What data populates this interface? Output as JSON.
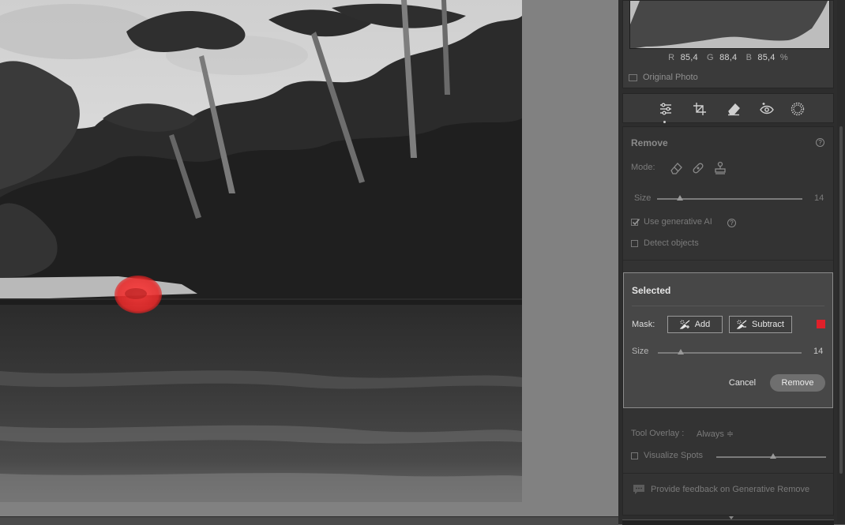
{
  "histogram": {
    "r_label": "R",
    "r_value": "85,4",
    "g_label": "G",
    "g_value": "88,4",
    "b_label": "B",
    "b_value": "85,4",
    "unit": "%"
  },
  "original_photo": {
    "label": "Original Photo",
    "checked": false
  },
  "tools": [
    {
      "icon": "edit-sliders-icon",
      "active": true
    },
    {
      "icon": "crop-icon"
    },
    {
      "icon": "remove-eraser-icon"
    },
    {
      "icon": "red-eye-icon"
    },
    {
      "icon": "masking-icon"
    }
  ],
  "remove_panel": {
    "title": "Remove",
    "mode_label": "Mode:",
    "size_label": "Size",
    "size_value": "14",
    "size_level": 0.16,
    "use_generative_ai": {
      "label": "Use generative AI",
      "checked": true
    },
    "detect_objects": {
      "label": "Detect objects",
      "checked": false
    },
    "tool_overlay_label": "Tool Overlay :",
    "tool_overlay_value": "Always ≑",
    "visualize_spots": {
      "label": "Visualize Spots",
      "checked": false,
      "level": 0.52
    },
    "feedback_label": "Provide feedback on Generative Remove"
  },
  "selected_panel": {
    "title": "Selected",
    "mask_label": "Mask:",
    "add_label": "Add",
    "subtract_label": "Subtract",
    "mask_color": "#e0202a",
    "size_label": "Size",
    "size_value": "14",
    "size_level": 0.16,
    "cancel_label": "Cancel",
    "remove_label": "Remove"
  },
  "colors": {
    "panel_bg": "#2d2d2d",
    "accent_mask": "#e0202a",
    "canvas_bg": "#818181"
  }
}
